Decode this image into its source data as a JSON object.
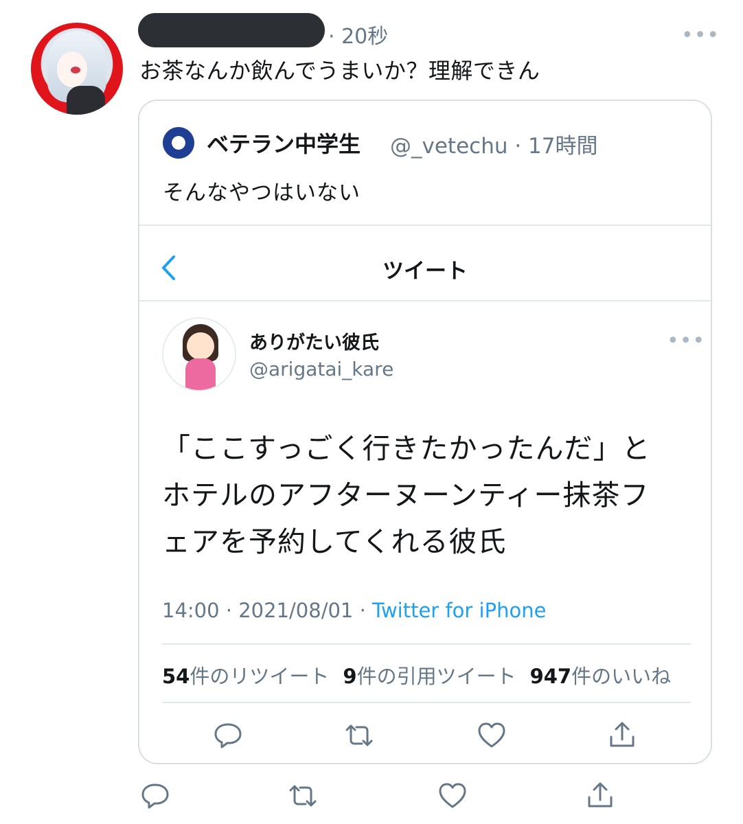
{
  "tweet": {
    "time": "· 20秒",
    "more": "•••",
    "text": "お茶なんか飲んでうまいか？理解できん"
  },
  "quoted": {
    "name": "ベテラン中学生",
    "handle_time": "@_vetechu · 17時間",
    "text": "そんなやつはいない",
    "screenshot": {
      "header_title": "ツイート",
      "author_name": "ありがたい彼氏",
      "author_handle": "@arigatai_kare",
      "more": "•••",
      "body_lines": [
        "「ここすっごく行きたかったんだ」と",
        "ホテルのアフターヌーンティー抹茶フ",
        "ェアを予約してくれる彼氏"
      ],
      "timestamp": "14:00 · 2021/08/01 · ",
      "source": "Twitter for iPhone",
      "stats": {
        "retweets_count": "54",
        "retweets_label": "件のリツイート",
        "quotes_count": "9",
        "quotes_label": "件の引用ツイート",
        "likes_count": "947",
        "likes_label": "件のいいね"
      }
    }
  },
  "icons": [
    "reply-icon",
    "retweet-icon",
    "like-icon",
    "share-icon",
    "chevron-left-icon",
    "more-icon"
  ],
  "colors": {
    "accent": "#1da1f2",
    "text": "#14171a",
    "muted": "#657786",
    "border": "#e1e8ed",
    "icon": "#657786",
    "redaction": "#2c2f33"
  }
}
